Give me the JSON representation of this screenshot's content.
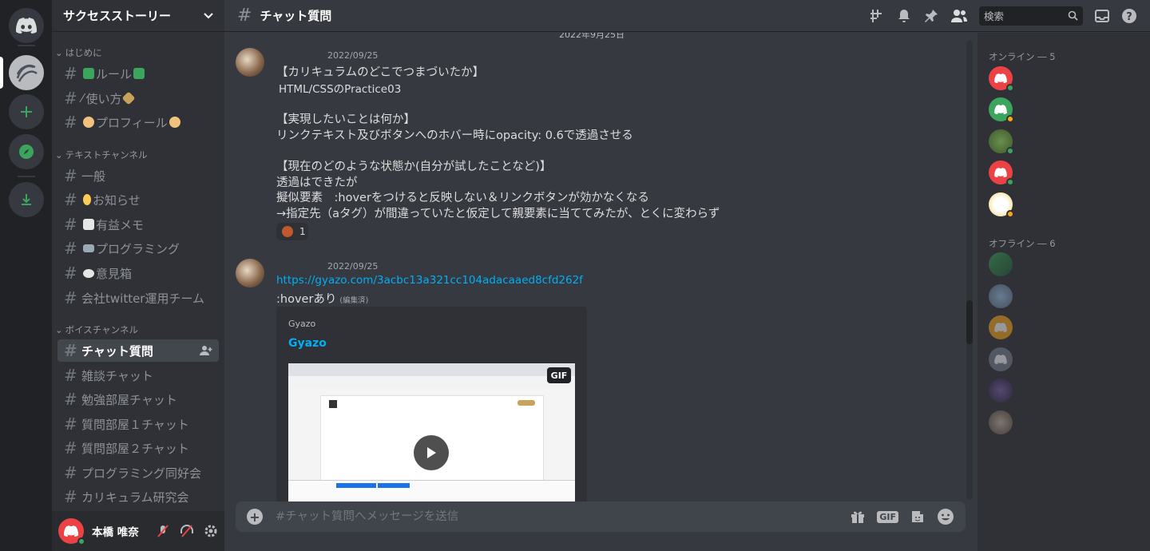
{
  "guild": {
    "name": "サクセスストーリー"
  },
  "categories": {
    "intro": "はじめに",
    "text": "テキストチャンネル",
    "voice": "ボイスチャンネル"
  },
  "channels": {
    "intro": [
      {
        "label": "ルール"
      },
      {
        "label": "使い方"
      },
      {
        "label": "プロフィール"
      }
    ],
    "text": [
      {
        "label": "一般"
      },
      {
        "label": "お知らせ"
      },
      {
        "label": "有益メモ"
      },
      {
        "label": "プログラミング"
      },
      {
        "label": "意見箱"
      },
      {
        "label": "会社twitter運用チーム"
      }
    ],
    "voice": [
      {
        "label": "チャット質問"
      },
      {
        "label": "雑談チャット"
      },
      {
        "label": "勉強部屋チャット"
      },
      {
        "label": "質問部屋１チャット"
      },
      {
        "label": "質問部屋２チャット"
      },
      {
        "label": "プログラミング同好会"
      },
      {
        "label": "カリキュラム研究会"
      }
    ]
  },
  "user": {
    "name": "本橋 唯奈"
  },
  "header": {
    "channel": "チャット質問",
    "search_placeholder": "検索"
  },
  "chat": {
    "date_divider": "2022年9月25日",
    "messages": [
      {
        "timestamp": "2022/09/25",
        "lines": [
          "【カリキュラムのどこでつまづいたか】",
          "HTML/CSSのPractice03",
          "【実現したいことは何か】",
          "リンクテキスト及びボタンへのホバー時にopacity: 0.6で透過させる",
          "【現在のどのような状態か(自分が試したことなど)】",
          "透過はできたが",
          "擬似要素　:hoverをつけると反映しない＆リンクボタンが効かなくなる",
          "→指定先（aタグ）が間違っていたと仮定して親要素に当ててみたが、とくに変わらず"
        ],
        "reaction_count": "1"
      },
      {
        "timestamp": "2022/09/25",
        "link": "https://gyazo.com/3acbc13a321cc104adacaaed8cfd262f",
        "text": ":hoverあり",
        "edited": "(編集済)",
        "embed": {
          "provider": "Gyazo",
          "title": "Gyazo",
          "badge": "GIF"
        }
      }
    ]
  },
  "composer": {
    "placeholder": "#チャット質問へメッセージを送信",
    "gif_label": "GIF"
  },
  "members": {
    "online_label": "オンライン ― 5",
    "offline_label": "オフライン ― 6"
  },
  "colors": {
    "accent": "#5865f2",
    "online": "#3ba55d",
    "idle": "#faa81a",
    "link": "#00aff4",
    "danger": "#ed4245"
  }
}
